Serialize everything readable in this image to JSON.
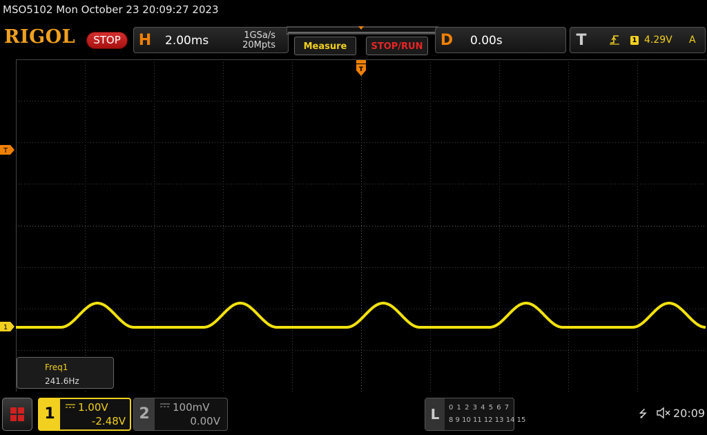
{
  "status_line": "MSO5102  Mon October 23 20:09:27 2023",
  "logo": "RIGOL",
  "run_state": "STOP",
  "horizontal": {
    "letter": "H",
    "timebase": "2.00ms",
    "sample_rate": "1GSa/s",
    "memory_depth": "20Mpts"
  },
  "buttons": {
    "measure": "Measure",
    "stop_run": "STOP/RUN"
  },
  "delay": {
    "letter": "D",
    "value": "0.00s"
  },
  "trigger": {
    "letter": "T",
    "slope_icon": "rising-edge-icon",
    "source": "1",
    "level": "4.29V",
    "mode": "A",
    "level_marker": "T"
  },
  "waveform": {
    "channel_marker": "1",
    "color": "#f2e10f",
    "period_divisions": 2.07
  },
  "measurement": {
    "label": "Freq1",
    "value": "241.6Hz"
  },
  "channels": [
    {
      "number": "1",
      "coupling_icon": "dc-coupling-icon",
      "scale": "1.00V",
      "offset": "-2.48V",
      "active": true,
      "color": "#f2d020"
    },
    {
      "number": "2",
      "coupling_icon": "dc-coupling-icon",
      "scale": "100mV",
      "offset": "0.00V",
      "active": false,
      "color": "#aaaaaa"
    }
  ],
  "logic": {
    "letter": "L",
    "row1": "0 1 2 3  4 5 6 7",
    "row2": "8 9 10 11 12 13 14 15"
  },
  "system": {
    "usb_icon": "usb-icon",
    "speaker_icon": "speaker-muted-icon",
    "time": "20:09"
  },
  "colors": {
    "accent_orange": "#f08000",
    "ch1_yellow": "#f2d020",
    "stop_red": "#d73030"
  }
}
